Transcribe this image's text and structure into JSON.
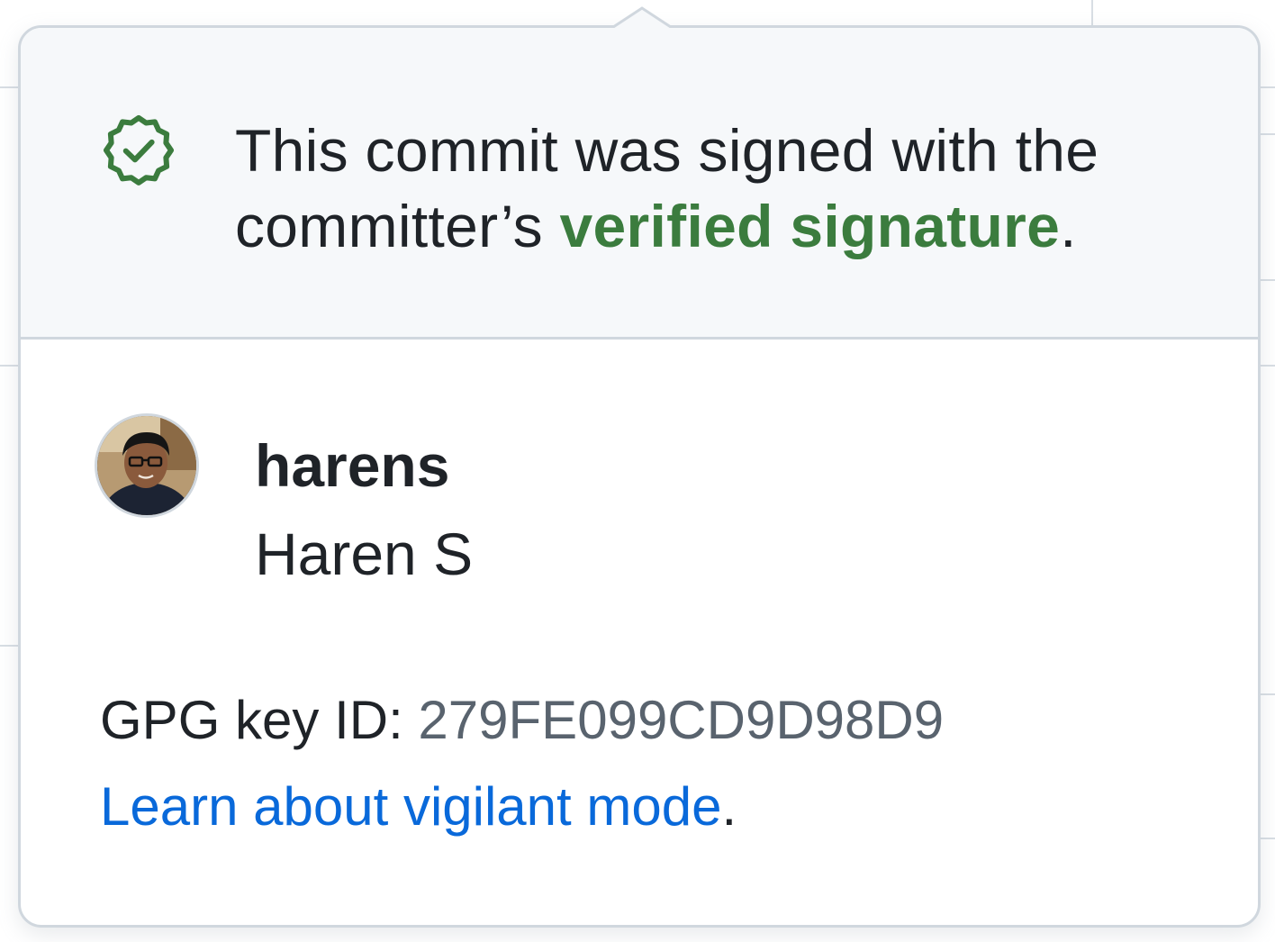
{
  "header": {
    "message_prefix": "This commit was signed with the committer’s",
    "verified_link_text": "verified signature",
    "message_suffix": "."
  },
  "user": {
    "login": "harens",
    "full_name": "Haren S"
  },
  "gpg": {
    "label": "GPG key ID:",
    "key_id": "279FE099CD9D98D9"
  },
  "learn_more": {
    "link_text": "Learn about vigilant mode",
    "suffix": "."
  },
  "colors": {
    "verified_green": "#3b7c3e",
    "link_blue": "#0969da",
    "muted_text": "#59636e",
    "border": "#d0d7de",
    "header_bg": "#f6f8fa"
  },
  "icons": {
    "verified": "verified-badge-check-icon"
  }
}
